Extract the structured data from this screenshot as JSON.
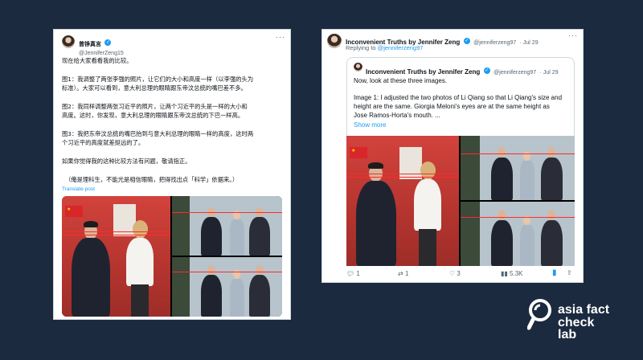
{
  "left_post": {
    "author_name": "曾铮真言",
    "author_handle": "@JenniferZeng15",
    "intro": "现在给大家看看我的比较。",
    "fig1": [
      "图1：我调整了两张李强的照片，让它们的大小和高度一样（以李强的头为",
      "标准）。大家可以看到，意大利总理的眼睛跟东帝汶总统的嘴巴差不多。"
    ],
    "fig2": [
      "图2：我同样调整两张习近平的照片，让两个习近平的头是一样的大小和",
      "高度。这时，你发现，意大利总理的眼睛跟东帝汶总统的下巴一样高。"
    ],
    "fig3": [
      "图3：我把东帝汶总统的嘴巴抬到与意大利总理的眼睛一样的高度，这时两",
      "个习近平的高度就差挺远的了。"
    ],
    "closing": "如果你觉得我的这种比较方法有问题，敬请指正。",
    "note": "（俺是理科生，不能光是相信眼睛，把得找出点「科学」依据来。）",
    "translate": "Translate post"
  },
  "right_post": {
    "author_name": "Inconvenient Truths by Jennifer Zeng",
    "author_handle": "@jenniferzeng97",
    "date": "· Jul 29",
    "replying_prefix": "Replying to ",
    "replying_handle": "@jenniferzeng97",
    "quote": {
      "author_name": "Inconvenient Truths by Jennifer Zeng",
      "author_handle": "@jenniferzeng97",
      "date": "· Jul 29",
      "line1": "Now, look at these three images.",
      "line2": "Image 1: I adjusted the two photos of Li Qiang so that Li Qiang's size and",
      "line3": "height are the same. Giorgia Meloni's eyes are at the same height as",
      "line4": "Jose Ramos-Horta's mouth. ...",
      "show_more": "Show more"
    },
    "actions": {
      "replies": "1",
      "retweets": "1",
      "likes": "3",
      "views": "5.3K"
    }
  },
  "logo": {
    "line1": "asia fact",
    "line2": "check lab"
  },
  "colors": {
    "background": "#1b2a3f",
    "link": "#1d9bf0",
    "red_guideline": "#ff2a2a"
  }
}
